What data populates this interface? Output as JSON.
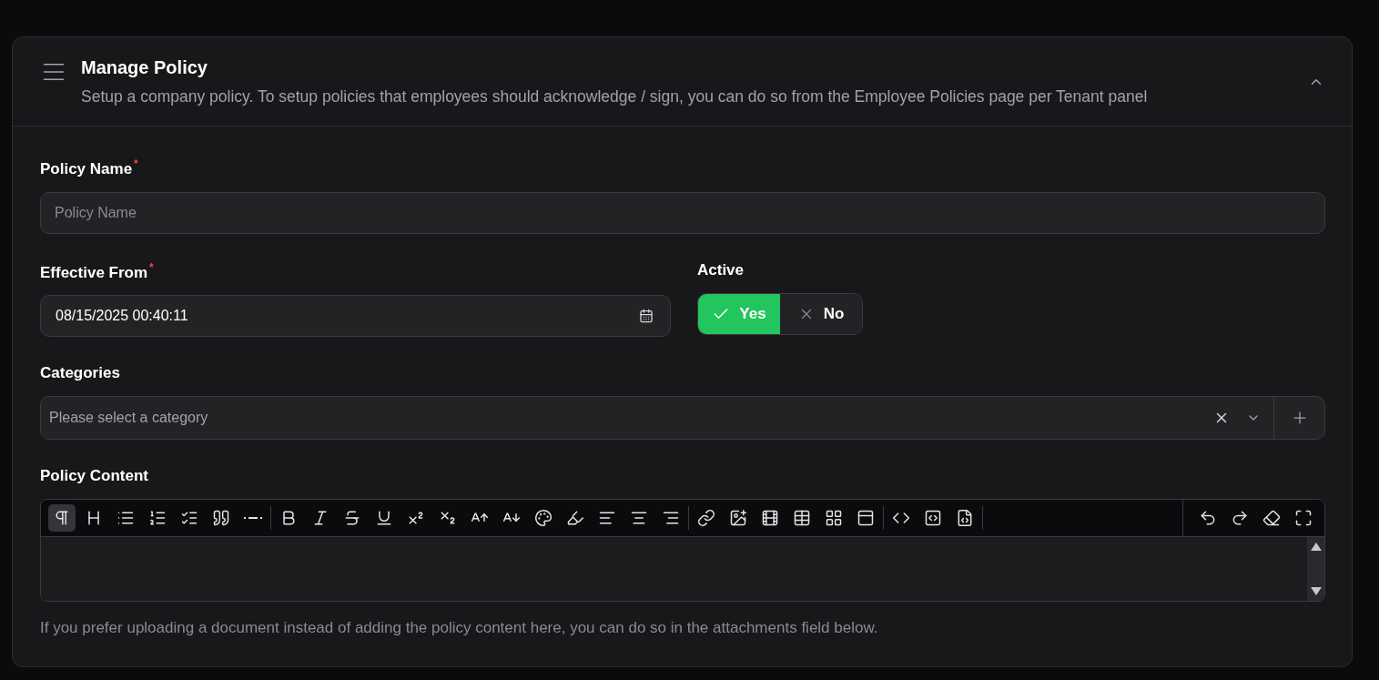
{
  "panel": {
    "title": "Manage Policy",
    "description": "Setup a company policy. To setup policies that employees should acknowledge / sign, you can do so from the Employee Policies page per Tenant panel",
    "expanded": true
  },
  "policy_name": {
    "label": "Policy Name",
    "required_mark": "*",
    "placeholder": "Policy Name"
  },
  "effective_from": {
    "label": "Effective From",
    "required_mark": "*",
    "value": "08/15/2025 00:40:11"
  },
  "active": {
    "label": "Active",
    "options": [
      {
        "label": "Yes",
        "kind": "yes",
        "selected": true
      },
      {
        "label": "No",
        "kind": "no",
        "selected": false
      }
    ]
  },
  "categories": {
    "label": "Categories",
    "placeholder": "Please select a category"
  },
  "policy_content": {
    "label": "Policy Content",
    "hint": "If you prefer uploading a document instead of adding the policy content here, you can do so in the attachments field below.",
    "toolbar": [
      [
        {
          "kind": "paragraph",
          "selected": true
        },
        {
          "kind": "heading",
          "selected": false
        },
        {
          "kind": "bullet-list",
          "selected": false
        },
        {
          "kind": "ordered-list",
          "selected": false
        },
        {
          "kind": "checklist",
          "selected": false
        },
        {
          "kind": "quote",
          "selected": false
        },
        {
          "kind": "rule",
          "selected": false
        }
      ],
      [
        {
          "kind": "bold",
          "selected": false
        },
        {
          "kind": "italic",
          "selected": false
        },
        {
          "kind": "strike",
          "selected": false
        },
        {
          "kind": "underline",
          "selected": false
        },
        {
          "kind": "superscript",
          "selected": false
        },
        {
          "kind": "subscript",
          "selected": false
        },
        {
          "kind": "grow",
          "selected": false
        },
        {
          "kind": "shrink",
          "selected": false
        },
        {
          "kind": "color",
          "selected": false
        },
        {
          "kind": "highlight",
          "selected": false
        },
        {
          "kind": "align-left",
          "selected": false
        },
        {
          "kind": "align-center",
          "selected": false
        },
        {
          "kind": "align-right",
          "selected": false
        }
      ],
      [
        {
          "kind": "link",
          "selected": false
        },
        {
          "kind": "image",
          "selected": false
        },
        {
          "kind": "video",
          "selected": false
        },
        {
          "kind": "table",
          "selected": false
        },
        {
          "kind": "grid",
          "selected": false
        },
        {
          "kind": "panel",
          "selected": false
        }
      ],
      [
        {
          "kind": "code",
          "selected": false
        },
        {
          "kind": "code-block",
          "selected": false
        },
        {
          "kind": "source",
          "selected": false
        }
      ]
    ],
    "toolbar_end": [
      {
        "kind": "undo",
        "selected": false
      },
      {
        "kind": "redo",
        "selected": false
      },
      {
        "kind": "eraser",
        "selected": false
      },
      {
        "kind": "fullscreen",
        "selected": false
      }
    ]
  }
}
